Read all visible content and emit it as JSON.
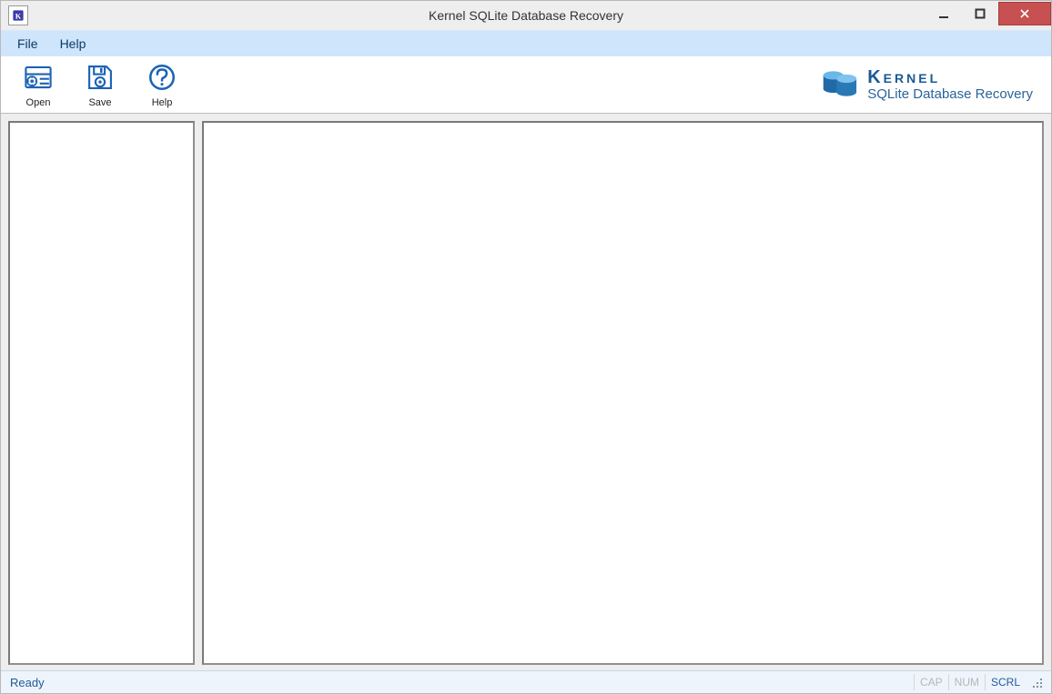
{
  "window": {
    "title": "Kernel SQLite Database Recovery"
  },
  "menu": {
    "file": "File",
    "help": "Help"
  },
  "toolbar": {
    "open": "Open",
    "save": "Save",
    "help": "Help"
  },
  "brand": {
    "name": "Kernel",
    "subtitle": "SQLite Database Recovery"
  },
  "status": {
    "text": "Ready",
    "cap": "CAP",
    "num": "NUM",
    "scrl": "SCRL"
  }
}
